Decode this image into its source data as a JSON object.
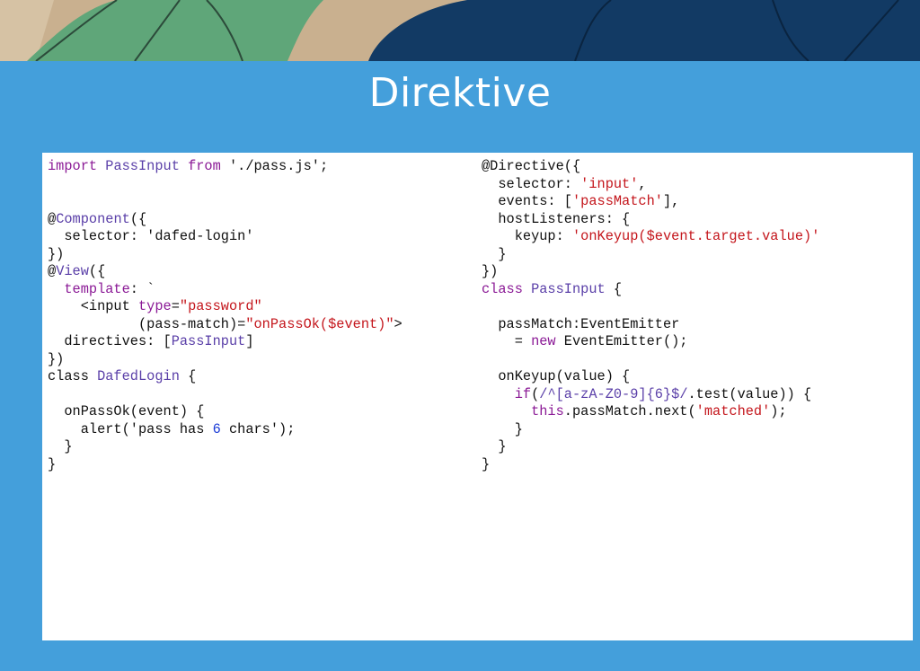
{
  "slide": {
    "title": "Direktive"
  },
  "code": {
    "left": [
      [
        {
          "c": "k",
          "t": "import "
        },
        {
          "c": "t",
          "t": "PassInput "
        },
        {
          "c": "k",
          "t": "from "
        },
        {
          "c": "",
          "t": "'./pass.js';"
        }
      ],
      [],
      [],
      [
        {
          "c": "",
          "t": "@"
        },
        {
          "c": "t",
          "t": "Component"
        },
        {
          "c": "",
          "t": "({"
        }
      ],
      [
        {
          "c": "",
          "t": "  selector: 'dafed-login'"
        }
      ],
      [
        {
          "c": "",
          "t": "})"
        }
      ],
      [
        {
          "c": "",
          "t": "@"
        },
        {
          "c": "t",
          "t": "View"
        },
        {
          "c": "",
          "t": "({"
        }
      ],
      [
        {
          "c": "",
          "t": "  "
        },
        {
          "c": "k",
          "t": "template"
        },
        {
          "c": "",
          "t": ": `"
        }
      ],
      [
        {
          "c": "",
          "t": "    <input "
        },
        {
          "c": "k",
          "t": "type"
        },
        {
          "c": "",
          "t": "="
        },
        {
          "c": "s",
          "t": "\"password\""
        }
      ],
      [
        {
          "c": "",
          "t": "           (pass-match)="
        },
        {
          "c": "s",
          "t": "\"onPassOk($event)\""
        },
        {
          "c": "",
          "t": ">"
        }
      ],
      [
        {
          "c": "",
          "t": "  directives: ["
        },
        {
          "c": "t",
          "t": "PassInput"
        },
        {
          "c": "",
          "t": "]"
        }
      ],
      [
        {
          "c": "",
          "t": "})"
        }
      ],
      [
        {
          "c": "",
          "t": "class "
        },
        {
          "c": "t",
          "t": "DafedLogin "
        },
        {
          "c": "",
          "t": "{"
        }
      ],
      [],
      [
        {
          "c": "",
          "t": "  onPassOk(event) {"
        }
      ],
      [
        {
          "c": "",
          "t": "    alert('pass has "
        },
        {
          "c": "n",
          "t": "6"
        },
        {
          "c": "",
          "t": " chars');"
        }
      ],
      [
        {
          "c": "",
          "t": "  }"
        }
      ],
      [
        {
          "c": "",
          "t": "}"
        }
      ]
    ],
    "right": [
      [
        {
          "c": "",
          "t": "@Directive({"
        }
      ],
      [
        {
          "c": "",
          "t": "  selector: "
        },
        {
          "c": "s",
          "t": "'input'"
        },
        {
          "c": "",
          "t": ","
        }
      ],
      [
        {
          "c": "",
          "t": "  events: ["
        },
        {
          "c": "s",
          "t": "'passMatch'"
        },
        {
          "c": "",
          "t": "],"
        }
      ],
      [
        {
          "c": "",
          "t": "  hostListeners: {"
        }
      ],
      [
        {
          "c": "",
          "t": "    keyup: "
        },
        {
          "c": "s",
          "t": "'onKeyup($event.target.value)'"
        }
      ],
      [
        {
          "c": "",
          "t": "  }"
        }
      ],
      [
        {
          "c": "",
          "t": "})"
        }
      ],
      [
        {
          "c": "k",
          "t": "class "
        },
        {
          "c": "t",
          "t": "PassInput "
        },
        {
          "c": "",
          "t": "{"
        }
      ],
      [],
      [
        {
          "c": "",
          "t": "  passMatch:EventEmitter"
        }
      ],
      [
        {
          "c": "",
          "t": "    = "
        },
        {
          "c": "k",
          "t": "new "
        },
        {
          "c": "",
          "t": "EventEmitter();"
        }
      ],
      [],
      [
        {
          "c": "",
          "t": "  onKeyup(value) {"
        }
      ],
      [
        {
          "c": "",
          "t": "    "
        },
        {
          "c": "k",
          "t": "if"
        },
        {
          "c": "",
          "t": "("
        },
        {
          "c": "t",
          "t": "/^[a-zA-Z0-9]{6}$/"
        },
        {
          "c": "",
          "t": ".test(value)) {"
        }
      ],
      [
        {
          "c": "",
          "t": "      "
        },
        {
          "c": "k",
          "t": "this"
        },
        {
          "c": "",
          "t": ".passMatch.next("
        },
        {
          "c": "s",
          "t": "'matched'"
        },
        {
          "c": "",
          "t": ");"
        }
      ],
      [
        {
          "c": "",
          "t": "    }"
        }
      ],
      [
        {
          "c": "",
          "t": "  }"
        }
      ],
      [
        {
          "c": "",
          "t": "}"
        }
      ]
    ]
  },
  "colors": {
    "background": "#449fdb",
    "panel": "#ffffff",
    "keyword": "#8b1a96",
    "type": "#5a3fa8",
    "string": "#c4161c",
    "number": "#1a3bd6"
  }
}
